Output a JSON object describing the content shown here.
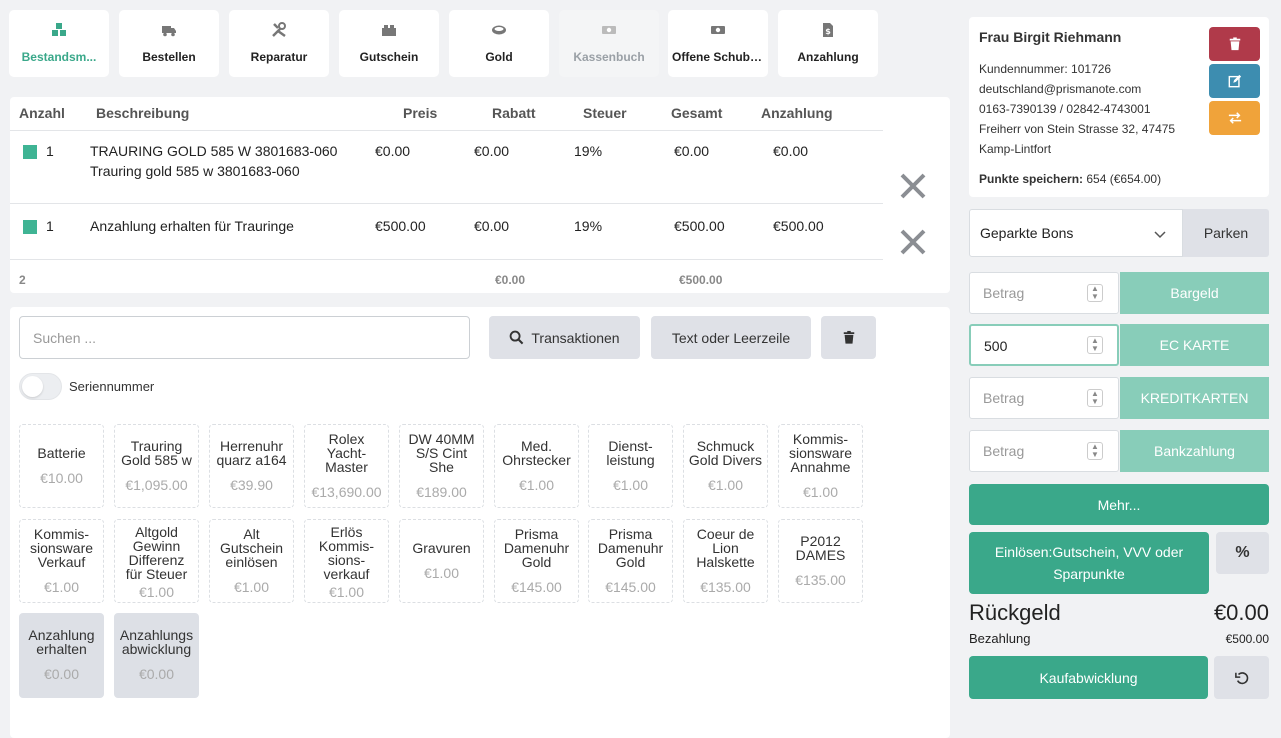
{
  "tabs": [
    {
      "label": "Bestandsm...",
      "icon": "boxes-icon",
      "state": "active"
    },
    {
      "label": "Bestellen",
      "icon": "truck-icon",
      "state": ""
    },
    {
      "label": "Reparatur",
      "icon": "tools-icon",
      "state": ""
    },
    {
      "label": "Gutschein",
      "icon": "gift-card-icon",
      "state": ""
    },
    {
      "label": "Gold",
      "icon": "gold-bar-icon",
      "state": ""
    },
    {
      "label": "Kassenbuch",
      "icon": "cash-icon",
      "state": "disabled"
    },
    {
      "label": "Offene Schublade",
      "icon": "cash-drawer-icon",
      "state": ""
    },
    {
      "label": "Anzahlung",
      "icon": "invoice-dollar-icon",
      "state": ""
    }
  ],
  "cart": {
    "headers": [
      "Anzahl",
      "Beschreibung",
      "Preis",
      "Rabatt",
      "Steuer",
      "Gesamt",
      "Anzahlung"
    ],
    "rows": [
      {
        "qty": "1",
        "desc1": "TRAURING GOLD 585 W 3801683-060",
        "desc2": "Trauring gold 585 w 3801683-060",
        "price": "€0.00",
        "discount": "€0.00",
        "tax": "19%",
        "total": "€0.00",
        "deposit": "€0.00"
      },
      {
        "qty": "1",
        "desc1": "Anzahlung erhalten für Trauringe",
        "desc2": "",
        "price": "€500.00",
        "discount": "€0.00",
        "tax": "19%",
        "total": "€500.00",
        "deposit": "€500.00"
      }
    ],
    "footer": {
      "count": "2",
      "discount_total": "€0.00",
      "grand_total": "€500.00"
    }
  },
  "search": {
    "placeholder": "Suchen ...",
    "transactions_label": "Transaktionen",
    "text_line_label": "Text oder Leerzeile",
    "serial_label": "Seriennummer"
  },
  "products": [
    {
      "name": [
        "Batterie"
      ],
      "price": "€10.00"
    },
    {
      "name": [
        "Trauring",
        "Gold 585 w"
      ],
      "price": "€1,095.00"
    },
    {
      "name": [
        "Herrenuhr",
        "quarz a164"
      ],
      "price": "€39.90"
    },
    {
      "name": [
        "Rolex",
        "Yacht-",
        "Master"
      ],
      "price": "€13,690.00"
    },
    {
      "name": [
        "DW 40MM",
        "S/S Cint",
        "She"
      ],
      "price": "€189.00"
    },
    {
      "name": [
        "Med.",
        "Ohrstecker"
      ],
      "price": "€1.00"
    },
    {
      "name": [
        "Dienst-",
        "leistung"
      ],
      "price": "€1.00"
    },
    {
      "name": [
        "Schmuck",
        "Gold Divers"
      ],
      "price": "€1.00"
    },
    {
      "name": [
        "Kommis-",
        "sionsware",
        "Annahme"
      ],
      "price": "€1.00"
    },
    {
      "name": [
        "Kommis-",
        "sionsware",
        "Verkauf"
      ],
      "price": "€1.00"
    },
    {
      "name": [
        "Altgold",
        "Gewinn",
        "Differenz",
        "für Steuer"
      ],
      "price": "€1.00"
    },
    {
      "name": [
        "Alt",
        "Gutschein",
        "einlösen"
      ],
      "price": "€1.00"
    },
    {
      "name": [
        "Erlös",
        "Kommis-",
        "sions-",
        "verkauf"
      ],
      "price": "€1.00"
    },
    {
      "name": [
        "Gravuren"
      ],
      "price": "€1.00"
    },
    {
      "name": [
        "Prisma",
        "Damenuhr",
        "Gold"
      ],
      "price": "€145.00"
    },
    {
      "name": [
        "Prisma",
        "Damenuhr",
        "Gold"
      ],
      "price": "€145.00"
    },
    {
      "name": [
        "Coeur de",
        "Lion",
        "Halskette"
      ],
      "price": "€135.00"
    },
    {
      "name": [
        "P2012",
        "DAMES"
      ],
      "price": "€135.00"
    },
    {
      "name": [
        "Anzahlung",
        "erhalten"
      ],
      "price": "€0.00"
    },
    {
      "name": [
        "Anzahlungs",
        "abwicklung"
      ],
      "price": "€0.00"
    }
  ],
  "customer": {
    "name": "Frau Birgit Riehmann",
    "number_line": "Kundennummer: 101726",
    "email": "deutschland@prismanote.com",
    "phones": "0163-7390139 / 02842-4743001",
    "address1": "Freiherr von Stein Strasse 32, 47475",
    "address2": "Kamp-Lintfort",
    "points_label": "Punkte speichern:",
    "points_value": "654 (€654.00)"
  },
  "park": {
    "selected": "Geparkte Bons",
    "button": "Parken"
  },
  "payments": [
    {
      "value": "",
      "placeholder": "Betrag",
      "label": "Bargeld"
    },
    {
      "value": "500",
      "placeholder": "Betrag",
      "label": "EC KARTE"
    },
    {
      "value": "",
      "placeholder": "Betrag",
      "label": "KREDITKARTEN"
    },
    {
      "value": "",
      "placeholder": "Betrag",
      "label": "Bankzahlung"
    }
  ],
  "more_label": "Mehr...",
  "redeem_label_1": "Einlösen:Gutschein, VVV oder",
  "redeem_label_2": "Sparpunkte",
  "percent_label": "%",
  "change": {
    "label": "Rückgeld",
    "value": "€0.00"
  },
  "payment_total": {
    "label": "Bezahlung",
    "value": "€500.00"
  },
  "checkout_label": "Kaufabwicklung",
  "colors": {
    "accent": "#3aa88a",
    "light_accent": "#88cdb9",
    "danger": "#b03a4a",
    "info": "#3d8db0",
    "warning": "#f0a33a"
  }
}
